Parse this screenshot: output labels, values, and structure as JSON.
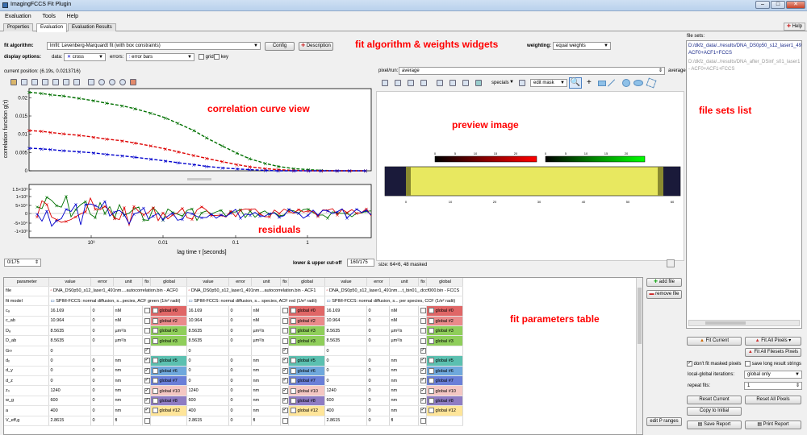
{
  "window": {
    "title": "ImagingFCCS Fit Plugin",
    "minimize": "–",
    "maximize": "□",
    "close": "✕"
  },
  "menu": [
    "Evaluation",
    "Tools",
    "Help"
  ],
  "tabs": [
    "Properties",
    "Evaluation",
    "Evaluation Results"
  ],
  "help_label": "Help",
  "fit_algorithm": {
    "label": "fit algorithm:",
    "value": "lmfit: Levenberg-Marquardt fit (with box constraints)",
    "config": "Config",
    "description": "Description"
  },
  "weighting": {
    "label": "weighting:",
    "value": "equal weights"
  },
  "display_options": {
    "label": "display options:",
    "data_label": "data:",
    "data_value": "cross",
    "errors_label": "errors:",
    "errors_value": "error bars",
    "grid_label": "grid",
    "key_label": "key"
  },
  "annotations": {
    "fit_widgets": "fit algorithm & weights widgets",
    "curve_view": "correlation curve view",
    "preview": "preview image",
    "filesets": "file sets list",
    "residuals": "residuals",
    "table": "fit parameters table"
  },
  "current_position": "current position: (6.19s, 0.0213716)",
  "preview": {
    "pixel_label": "pixel/run:",
    "pixel_value": "average",
    "average_label": "average",
    "specials": "specials",
    "edit_mask": "edit mask",
    "size_label": "size: 64×6, 48 masked",
    "cb1_ticks": [
      "0",
      "5",
      "10",
      "15",
      "20"
    ],
    "cb2_ticks": [
      "0",
      "5",
      "10",
      "15",
      "20"
    ],
    "img_ticks": [
      "0",
      "10",
      "20",
      "30",
      "40",
      "50",
      "60"
    ]
  },
  "cutoff": {
    "label": "lower & upper cut-off",
    "low": "0/175",
    "high": "160/175"
  },
  "chart_data": [
    {
      "type": "scatter",
      "ylabel": "correlation function g(τ)",
      "yticks": [
        "0",
        "0.005",
        "0.01",
        "0.015",
        "0.02"
      ],
      "ylim": [
        0,
        0.0225
      ],
      "xscale": "log",
      "xlim": [
        0.0001,
        6
      ],
      "series": [
        {
          "color": "#007000",
          "x": [
            0.0001,
            0.00015,
            0.0002,
            0.0003,
            0.0005,
            0.0008,
            0.0012,
            0.002,
            0.003,
            0.005,
            0.008,
            0.012,
            0.02,
            0.03,
            0.05,
            0.08,
            0.12,
            0.2,
            0.3,
            0.5,
            0.8,
            1.2,
            2,
            3,
            5
          ],
          "y": [
            0.0215,
            0.0212,
            0.0208,
            0.0205,
            0.0198,
            0.0192,
            0.0185,
            0.0178,
            0.017,
            0.0158,
            0.0145,
            0.013,
            0.011,
            0.009,
            0.0068,
            0.0048,
            0.0033,
            0.002,
            0.0012,
            0.0006,
            0.0003,
            0.0001,
            0.0,
            0.0,
            0.0
          ]
        },
        {
          "color": "#dd0000",
          "x": [
            0.0001,
            0.00015,
            0.0002,
            0.0003,
            0.0005,
            0.0008,
            0.0012,
            0.002,
            0.003,
            0.005,
            0.008,
            0.012,
            0.02,
            0.03,
            0.05,
            0.08,
            0.12,
            0.2,
            0.3,
            0.5,
            0.8,
            1.2,
            2,
            3,
            5
          ],
          "y": [
            0.011,
            0.0108,
            0.0105,
            0.0101,
            0.0097,
            0.0092,
            0.0087,
            0.0082,
            0.0076,
            0.0068,
            0.006,
            0.0052,
            0.0042,
            0.0034,
            0.0025,
            0.0017,
            0.0011,
            0.0006,
            0.0003,
            0.0001,
            0.0,
            0.0,
            0.0,
            0.0,
            0.0
          ]
        },
        {
          "color": "#0000cc",
          "x": [
            0.0001,
            0.00015,
            0.0002,
            0.0003,
            0.0005,
            0.0008,
            0.0012,
            0.002,
            0.003,
            0.005,
            0.008,
            0.012,
            0.02,
            0.03,
            0.05,
            0.08,
            0.12,
            0.2,
            0.3,
            0.5,
            0.8,
            1.2,
            2,
            3,
            5
          ],
          "y": [
            0.0062,
            0.006,
            0.0058,
            0.0055,
            0.0052,
            0.0049,
            0.0045,
            0.0041,
            0.0037,
            0.0032,
            0.0027,
            0.0022,
            0.0017,
            0.0012,
            0.0008,
            0.0005,
            0.0003,
            0.0001,
            0.0,
            0.0,
            0.0,
            0.0,
            0.0,
            0.0,
            0.0
          ]
        }
      ]
    },
    {
      "type": "scatter",
      "xlabel": "lag time τ [seconds]",
      "xticks": [
        "10³",
        "0.01",
        "0.1",
        "1"
      ],
      "yticks": [
        "1.5×10³",
        "1×10³",
        "5×10⁴",
        "0",
        "-5×10⁴",
        "-1×10³"
      ],
      "xscale": "log"
    }
  ],
  "table": {
    "headers": [
      "parameter",
      "value",
      "error",
      "unit",
      "fix",
      "global",
      "value",
      "error",
      "unit",
      "fix",
      "global",
      "value",
      "error",
      "unit",
      "fix",
      "global"
    ],
    "file_row": {
      "label": "file",
      "c1": "DNA_DS0p50_s12_laser1_491nm....autocorrelation.bin - ACF0",
      "c2": "DNA_DS0p50_s12_laser1_491nm....autocorrelation.bin - ACF1",
      "c3": "DNA_DS0p50_s12_laser1_491nm....t_bin01_.dccf000.bin - FCCS"
    },
    "model_row": {
      "label": "fit model",
      "c1": "SPIM-FCCS: normal diffusion, s...pecies, ACF green (1/e² radii)",
      "c2": "SPIM-FCCS: normal diffusion, s... species, ACF red (1/e² radii)",
      "c3": "SPIM-FCCS: normal diffusion, s... per species, CCF (1/e² radii)"
    },
    "rows": [
      {
        "name": "cₐ",
        "value": "16.169",
        "error": "0",
        "unit": "nM",
        "fix": false,
        "global": "global #0",
        "color": "#e06666"
      },
      {
        "name": "c_ab",
        "value": "10.964",
        "error": "0",
        "unit": "nM",
        "fix": false,
        "global": "global #2",
        "color": "#ea8a8a"
      },
      {
        "name": "Dₐ",
        "value": "8.5635",
        "error": "0",
        "unit": "µm²/s",
        "fix": false,
        "global": "global #3",
        "color": "#8fce5a"
      },
      {
        "name": "D_ab",
        "value": "8.5635",
        "error": "0",
        "unit": "µm²/s",
        "fix": false,
        "global": "global #3",
        "color": "#8fce5a"
      },
      {
        "name": "G∞",
        "value": "0",
        "error": "",
        "unit": "",
        "fix": true,
        "global": "",
        "color": ""
      },
      {
        "name": "dₓ",
        "value": "0",
        "error": "0",
        "unit": "nm",
        "fix": true,
        "global": "global #5",
        "color": "#5bc0b0"
      },
      {
        "name": "d_y",
        "value": "0",
        "error": "0",
        "unit": "nm",
        "fix": true,
        "global": "global #6",
        "color": "#6fa8dc"
      },
      {
        "name": "d_z",
        "value": "0",
        "error": "0",
        "unit": "nm",
        "fix": true,
        "global": "global #7",
        "color": "#6a7fd8"
      },
      {
        "name": "z₀",
        "value": "1240",
        "error": "0",
        "unit": "nm",
        "fix": true,
        "global": "global #10",
        "color": "#f4c7c3"
      },
      {
        "name": "w_g",
        "value": "600",
        "error": "0",
        "unit": "nm",
        "fix": true,
        "global": "global #8",
        "color": "#8e7cc3"
      },
      {
        "name": "a",
        "value": "400",
        "error": "0",
        "unit": "nm",
        "fix": true,
        "global": "global #12",
        "color": "#ffe599"
      },
      {
        "name": "V_eff,g",
        "value": "2.8615",
        "error": "0",
        "unit": "fl",
        "fix": false,
        "global": "",
        "color": ""
      }
    ]
  },
  "table_buttons": {
    "add_file": "add file",
    "remove_file": "remove file",
    "edit_ranges": "edit P ranges"
  },
  "filesets": {
    "label": "file sets:",
    "items": [
      "D:/dkfz_data/../results/DNA_DS0p50_s12_laser1_491",
      "ACF0+ACF1+FCCS",
      "D:/dkfz_data/../results/DNA_after_DSinf_s01_laser1",
      "- ACF0+ACF1+FCCS"
    ]
  },
  "right_controls": {
    "fit_current": "Fit Current",
    "fit_all_pixels": "Fit All Pixels",
    "fit_all_filesets": "Fit All Filesets Pixels",
    "dont_fit_masked": "don't fit masked pixels",
    "save_long": "save long result strings",
    "lg_label": "local-global iterations:",
    "lg_value": "global only",
    "repeat_label": "repeat fits:",
    "repeat_value": "1",
    "reset_current": "Reset Current",
    "reset_all": "Reset All Pixels",
    "copy_initial": "Copy to Initial",
    "save_report": "Save Report",
    "print_report": "Print Report"
  }
}
